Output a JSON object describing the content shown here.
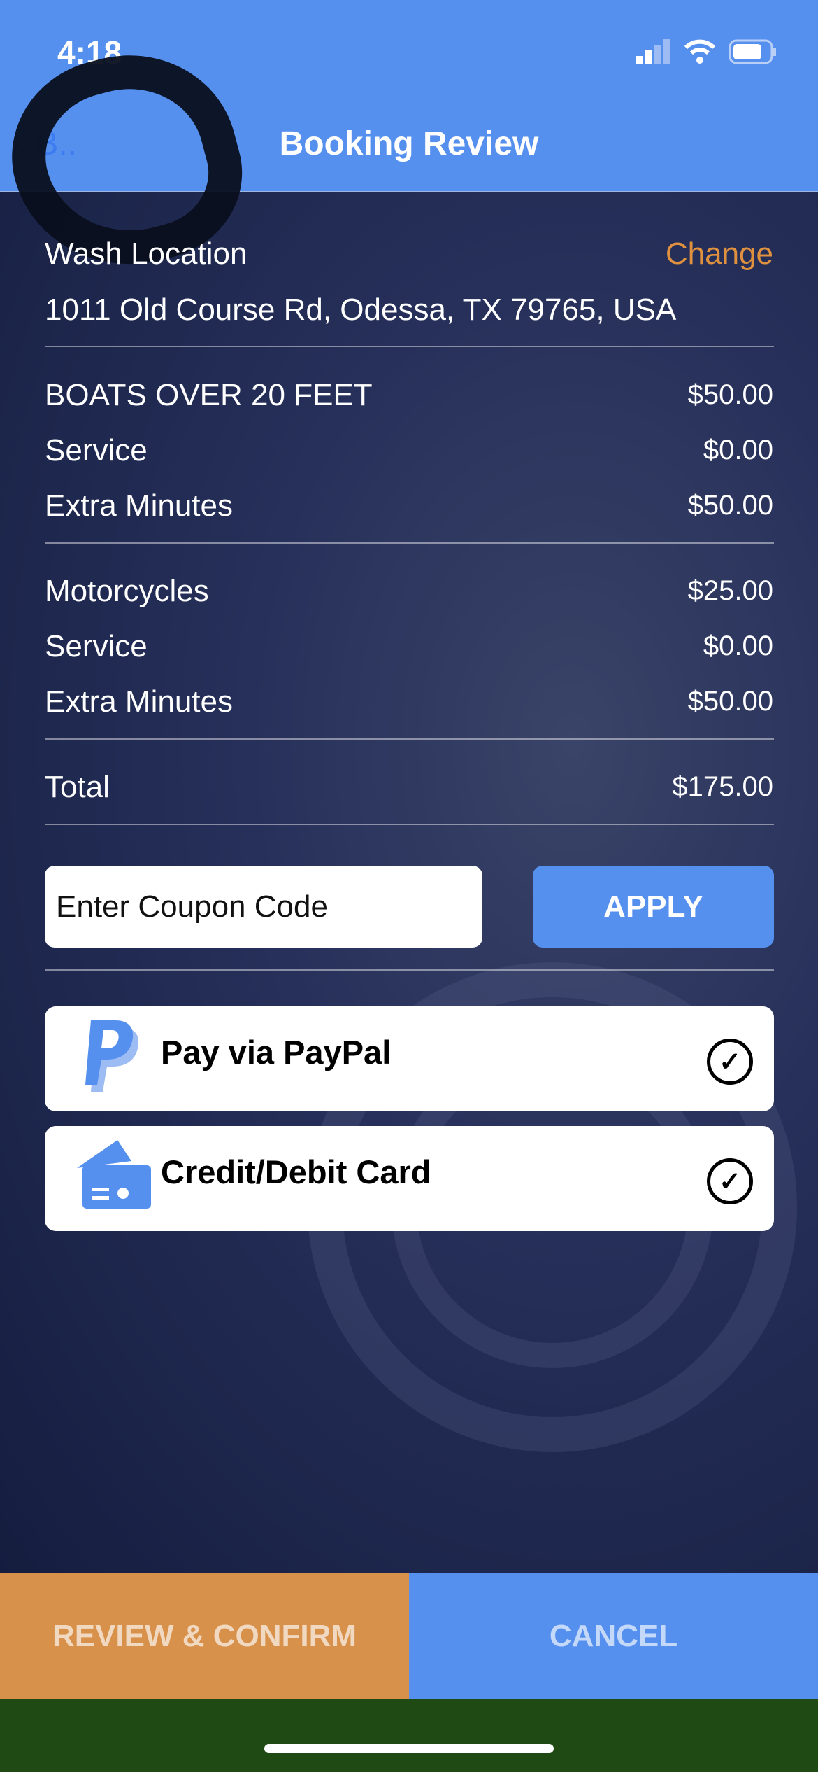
{
  "status_bar": {
    "time": "4:18"
  },
  "nav": {
    "back_label": "B..",
    "title": "Booking Review"
  },
  "location": {
    "label": "Wash Location",
    "change": "Change",
    "address": "1011 Old Course Rd, Odessa, TX 79765, USA"
  },
  "groups": [
    {
      "rows": [
        {
          "label": "BOATS OVER 20 FEET",
          "price": "$50.00"
        },
        {
          "label": "Service",
          "price": "$0.00"
        },
        {
          "label": "Extra Minutes",
          "price": "$50.00"
        }
      ]
    },
    {
      "rows": [
        {
          "label": "Motorcycles",
          "price": "$25.00"
        },
        {
          "label": "Service",
          "price": "$0.00"
        },
        {
          "label": "Extra Minutes",
          "price": "$50.00"
        }
      ]
    }
  ],
  "total": {
    "label": "Total",
    "price": "$175.00"
  },
  "coupon": {
    "placeholder": "Enter Coupon Code",
    "apply": "APPLY"
  },
  "payment": [
    {
      "label": "Pay via PayPal",
      "icon": "paypal-icon"
    },
    {
      "label": "Credit/Debit Card",
      "icon": "credit-card-icon"
    }
  ],
  "footer": {
    "confirm": "REVIEW & CONFIRM",
    "cancel": "CANCEL"
  },
  "colors": {
    "accent": "#5690EE",
    "orange": "#D8914A",
    "change": "#E0913F"
  }
}
